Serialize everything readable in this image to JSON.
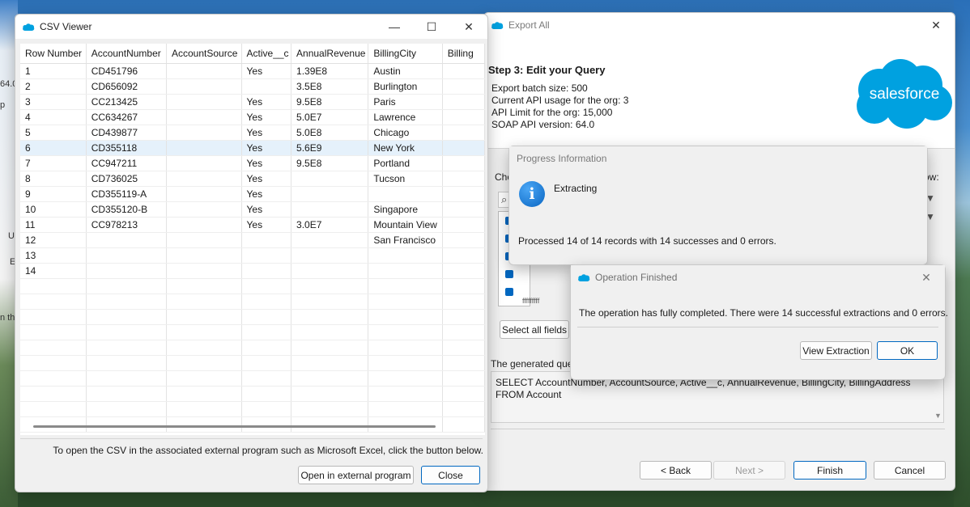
{
  "desktop": {
    "left_fragments": [
      "64.0",
      "p",
      "U",
      "E",
      "n th"
    ]
  },
  "export_window": {
    "title": "Export All",
    "step_title": "Step 3: Edit your Query",
    "info_lines": [
      "Export batch size: 500",
      "Current API usage for the org: 3",
      "API Limit for the org: 15,000",
      "SOAP API version: 64.0"
    ],
    "logo_text": "salesforce",
    "choose_partial": "Cho",
    "right_partial": "ow:",
    "field_partial": "fffffffff",
    "select_all_label": "Select all fields",
    "generated_label": "The generated que",
    "query_text_line1": "SELECT AccountNumber, AccountSource, Active__c, AnnualRevenue, BillingCity, BillingAddress",
    "query_text_line2": "FROM Account",
    "back_label": "< Back",
    "next_label": "Next >",
    "finish_label": "Finish",
    "cancel_label": "Cancel"
  },
  "csv_window": {
    "title": "CSV Viewer",
    "columns": [
      "Row Number",
      "AccountNumber",
      "AccountSource",
      "Active__c",
      "AnnualRevenue",
      "BillingCity",
      "Billing"
    ],
    "rows": [
      [
        "1",
        "CD451796",
        "",
        "Yes",
        "1.39E8",
        "Austin",
        ""
      ],
      [
        "2",
        "CD656092",
        "",
        "",
        "3.5E8",
        "Burlington",
        ""
      ],
      [
        "3",
        "CC213425",
        "",
        "Yes",
        "9.5E8",
        "Paris",
        ""
      ],
      [
        "4",
        "CC634267",
        "",
        "Yes",
        "5.0E7",
        "Lawrence",
        ""
      ],
      [
        "5",
        "CD439877",
        "",
        "Yes",
        "5.0E8",
        "Chicago",
        ""
      ],
      [
        "6",
        "CD355118",
        "",
        "Yes",
        "5.6E9",
        "New York",
        ""
      ],
      [
        "7",
        "CC947211",
        "",
        "Yes",
        "9.5E8",
        "Portland",
        ""
      ],
      [
        "8",
        "CD736025",
        "",
        "Yes",
        "",
        "Tucson",
        ""
      ],
      [
        "9",
        "CD355119-A",
        "",
        "Yes",
        "",
        "",
        ""
      ],
      [
        "10",
        "CD355120-B",
        "",
        "Yes",
        "",
        "Singapore",
        ""
      ],
      [
        "11",
        "CC978213",
        "",
        "Yes",
        "3.0E7",
        "Mountain View",
        ""
      ],
      [
        "12",
        "",
        "",
        "",
        "",
        "San Francisco",
        ""
      ],
      [
        "13",
        "",
        "",
        "",
        "",
        "",
        ""
      ],
      [
        "14",
        "",
        "",
        "",
        "",
        "",
        ""
      ]
    ],
    "selected_row": 6,
    "hint": "To open the CSV in the associated external program such as Microsoft Excel, click the button below.",
    "open_external_label": "Open in external program",
    "close_label": "Close"
  },
  "progress_dialog": {
    "title": "Progress Information",
    "status": "Extracting",
    "message": "Processed 14 of 14 records with 14 successes and 0 errors."
  },
  "finish_dialog": {
    "title": "Operation Finished",
    "message": "The operation has fully completed.  There were 14 successful extractions and 0 errors.",
    "view_label": "View Extraction",
    "ok_label": "OK"
  },
  "colors": {
    "accent": "#0067c0",
    "salesforce_blue": "#00a1e0",
    "selected_row": "#e5f1fb"
  }
}
